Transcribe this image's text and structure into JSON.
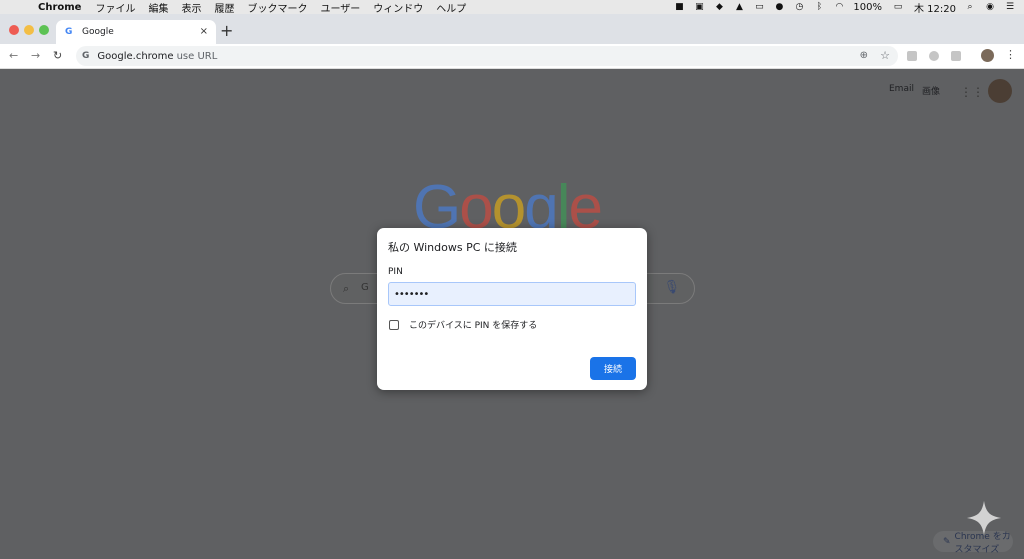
{
  "menubar": {
    "app_name": "Chrome",
    "items": [
      "ファイル",
      "編集",
      "表示",
      "履歴",
      "ブックマーク",
      "ユーザー",
      "ウィンドウ",
      "ヘルプ"
    ],
    "battery": "100%",
    "clock": "木 12:20"
  },
  "tab": {
    "title": "Google",
    "close": "×"
  },
  "toolbar": {
    "url_host": "Google.chrome",
    "url_rest": "use URL"
  },
  "header_links": {
    "gmail": "Email",
    "images": "画像"
  },
  "logo": [
    "G",
    "o",
    "o",
    "g",
    "l",
    "e"
  ],
  "logo_colors": [
    "#4285f4",
    "#ea4335",
    "#fbbc05",
    "#4285f4",
    "#34a853",
    "#ea4335"
  ],
  "search": {
    "partial_text": "G"
  },
  "customize": {
    "label": "Chrome をカスタマイズ"
  },
  "dialog": {
    "title": "私の Windows PC に接続",
    "pin_label": "PIN",
    "pin_value": "•••••••",
    "remember_label": "このデバイスに PIN を保存する",
    "remember_checked": false,
    "connect_label": "接続"
  },
  "colors": {
    "accent": "#1a73e8",
    "overlay": "#5f6062"
  }
}
